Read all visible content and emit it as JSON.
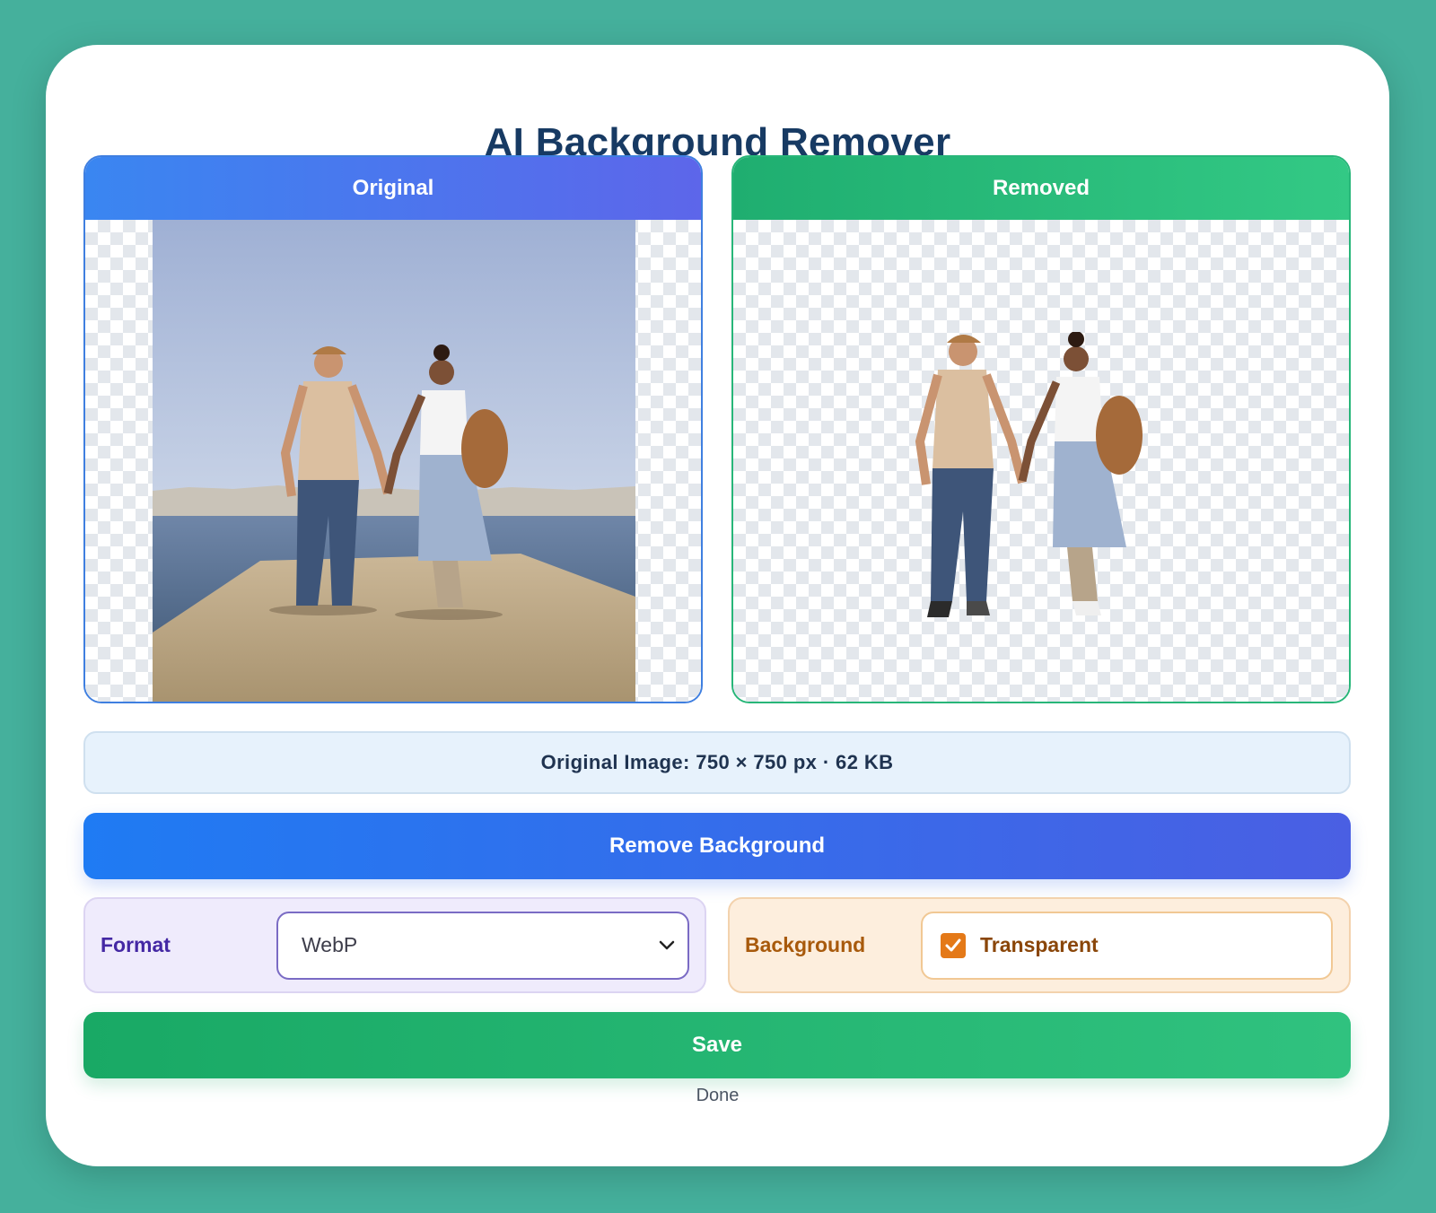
{
  "app": {
    "title": "AI Background Remover"
  },
  "panels": {
    "original": {
      "label": "Original"
    },
    "removed": {
      "label": "Removed"
    }
  },
  "info": {
    "text": "Original Image: 750 × 750 px · 62 KB"
  },
  "actions": {
    "remove_label": "Remove Background",
    "save_label": "Save"
  },
  "format": {
    "label": "Format",
    "selected": "WebP"
  },
  "background": {
    "label": "Background",
    "option_label": "Transparent",
    "checked": true
  },
  "status": {
    "text": "Done"
  },
  "colors": {
    "page_bg": "#45b09c",
    "title": "#173a63",
    "blue_accent": "#1f7bf3",
    "green_accent": "#19a965",
    "format_tint": "#efebfc",
    "background_tint": "#fdeedd",
    "checkbox": "#e47918"
  },
  "icons": [
    "chevron-down-icon",
    "checkmark-icon"
  ]
}
